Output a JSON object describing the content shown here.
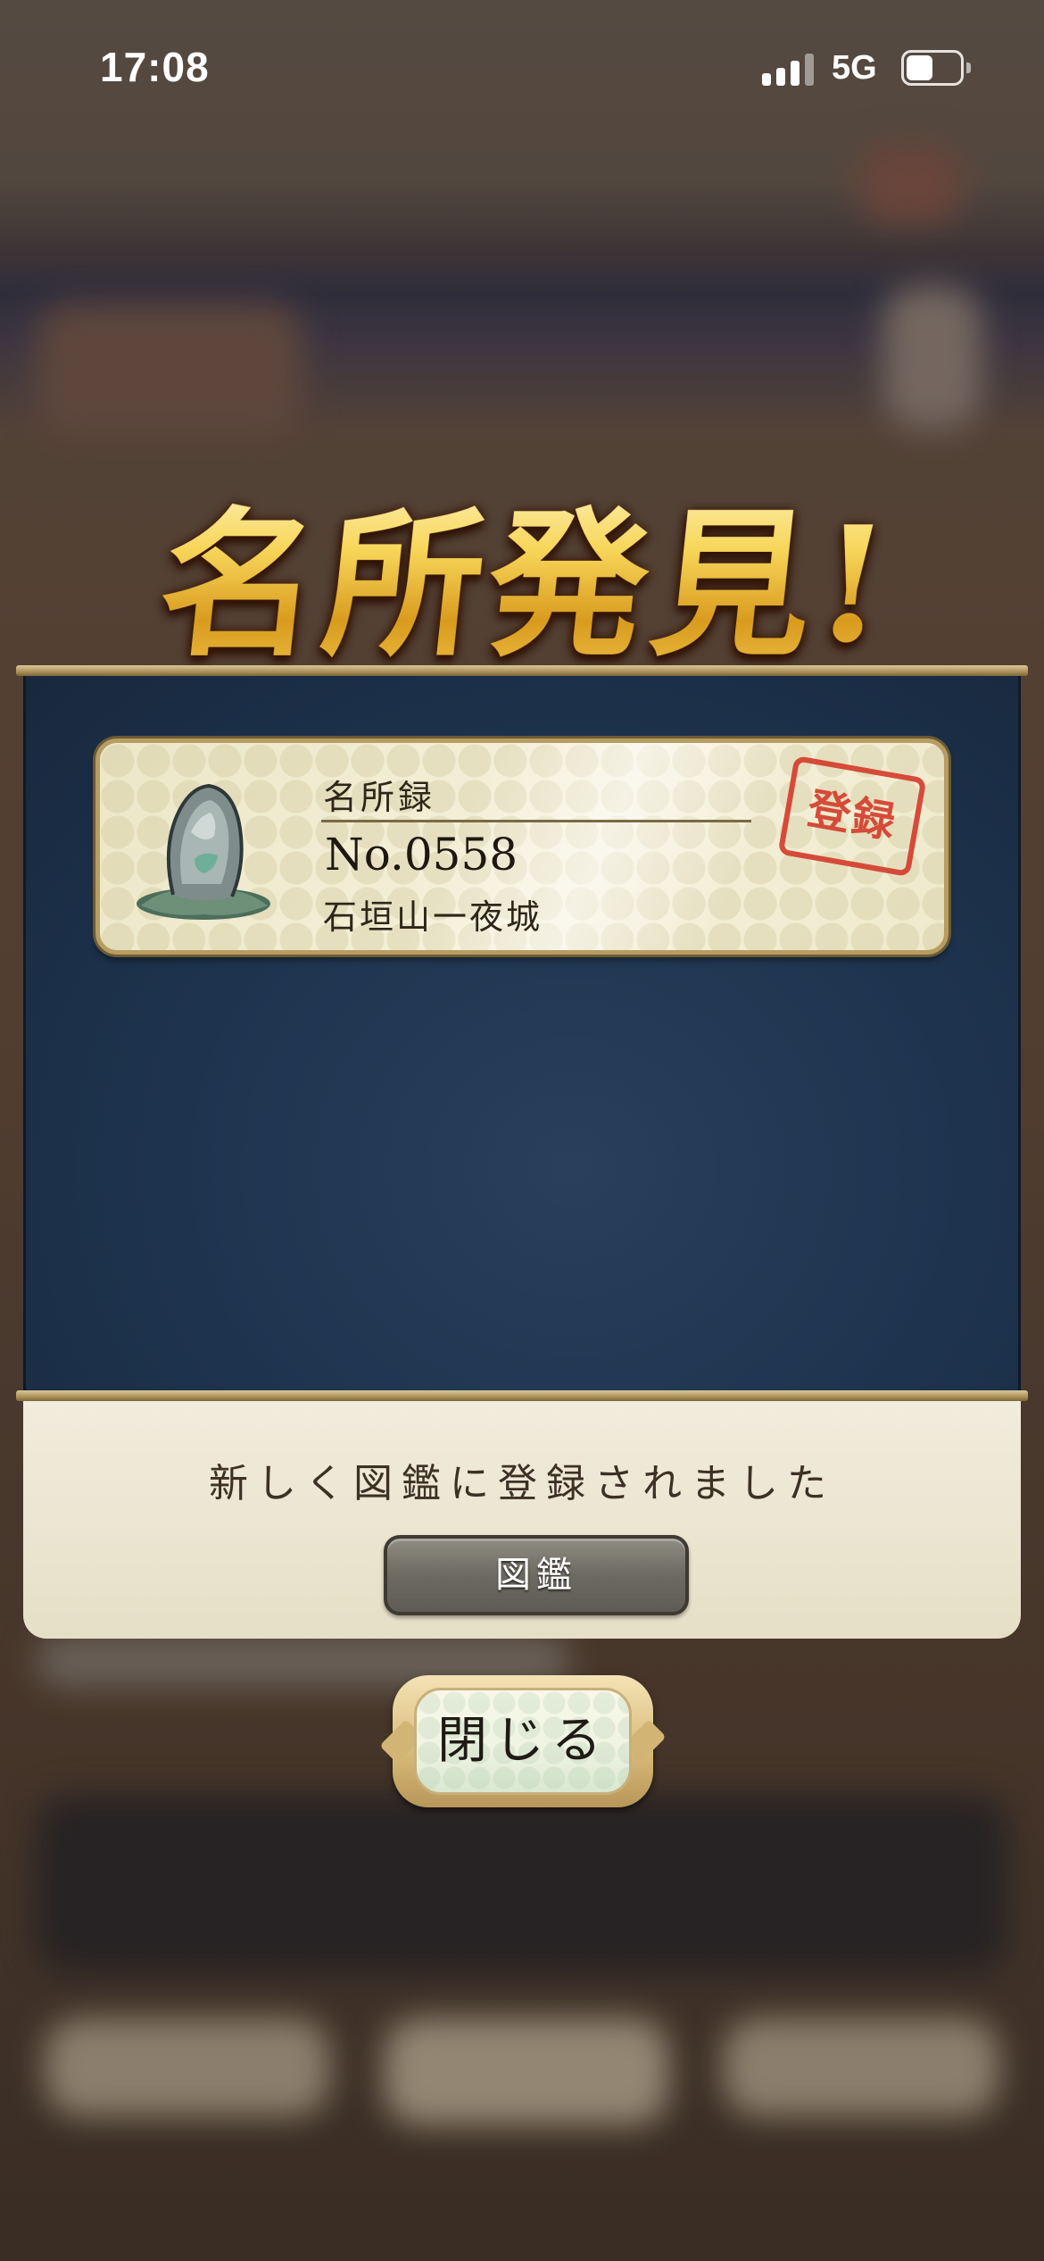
{
  "status_bar": {
    "time": "17:08",
    "network": "5G",
    "battery_level": 0.5
  },
  "banner": {
    "title": "名所発見!"
  },
  "card": {
    "label": "名所録",
    "number": "No.0558",
    "place_name": "石垣山一夜城",
    "stamp": "登録",
    "icon": "rock-icon"
  },
  "footer": {
    "message": "新しく図鑑に登録されました",
    "zukan_button_label": "図鑑"
  },
  "close_button": {
    "label": "閉じる"
  },
  "colors": {
    "panel_blue": "#1f3550",
    "panel_cream": "#f1ecdc",
    "gold": "#f3c93a",
    "stamp_red": "#d43a2a"
  }
}
